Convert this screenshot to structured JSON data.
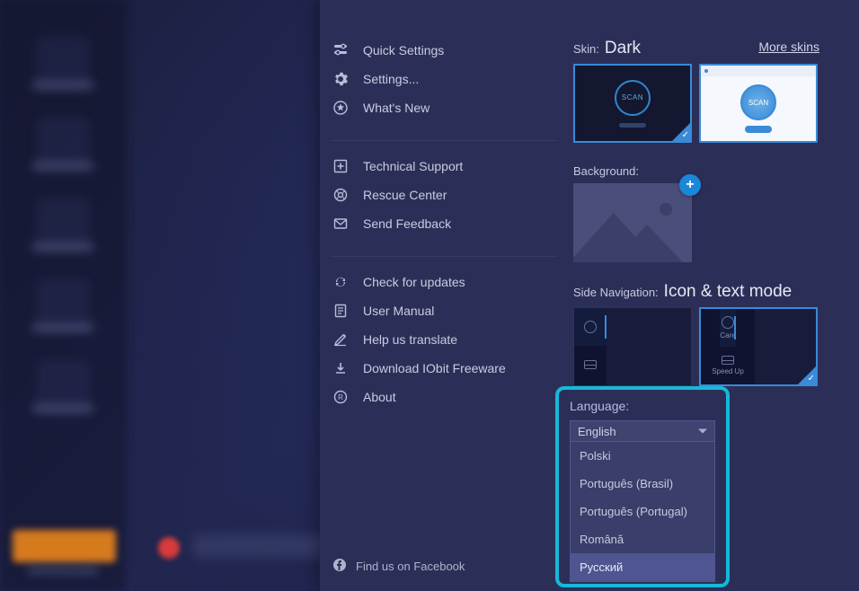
{
  "sidebar_blurred": {
    "items": [
      "Care",
      "Speed Up",
      "Protect",
      "Software Updater",
      "Action Center"
    ]
  },
  "menu": {
    "group1": [
      {
        "icon": "sliders",
        "label": "Quick Settings"
      },
      {
        "icon": "gear",
        "label": "Settings..."
      },
      {
        "icon": "star",
        "label": "What's New"
      }
    ],
    "group2": [
      {
        "icon": "plus-box",
        "label": "Technical Support"
      },
      {
        "icon": "rescue",
        "label": "Rescue Center"
      },
      {
        "icon": "mail",
        "label": "Send Feedback"
      }
    ],
    "group3": [
      {
        "icon": "refresh",
        "label": "Check for updates"
      },
      {
        "icon": "manual",
        "label": "User Manual"
      },
      {
        "icon": "pencil",
        "label": "Help us translate"
      },
      {
        "icon": "download",
        "label": "Download IObit Freeware"
      },
      {
        "icon": "registered",
        "label": "About"
      }
    ],
    "facebook": "Find us on Facebook"
  },
  "panel": {
    "skin_label": "Skin:",
    "skin_value": "Dark",
    "more_skins": "More skins",
    "background_label": "Background:",
    "sidenav_label": "Side Navigation:",
    "sidenav_value": "Icon & text mode",
    "nav_compact": {
      "row1": "",
      "row2": ""
    },
    "nav_wide": {
      "row1": "Care",
      "row2": "Speed Up"
    },
    "scan_label": "SCAN"
  },
  "language": {
    "label": "Language:",
    "selected": "English",
    "options": [
      "Polski",
      "Português (Brasil)",
      "Português (Portugal)",
      "Română",
      "Русский"
    ],
    "hovered_index": 4
  }
}
